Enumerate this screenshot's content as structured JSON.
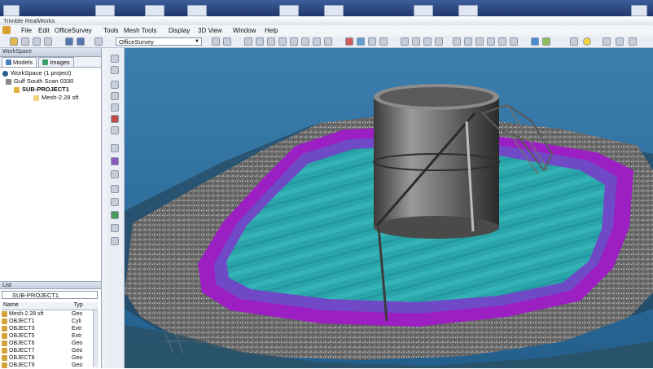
{
  "window": {
    "title": "Trimble RealWorks"
  },
  "menu": [
    "File",
    "Edit",
    "OfficeSurvey",
    "Tools",
    "Mesh Tools",
    "Display",
    "3D View",
    "Window",
    "Help"
  ],
  "toolbar": {
    "project_select": "OfficeSurvey"
  },
  "workspace": {
    "panel_title": "WorkSpace",
    "tabs": [
      "Models",
      "Images"
    ],
    "tree": [
      {
        "label": "WorkSpace (1 project)",
        "level": 0
      },
      {
        "label": "Gulf South Scan 0330",
        "level": 1
      },
      {
        "label": "SUB-PROJECT1",
        "level": 2
      },
      {
        "label": "Mesh-2.28 sft",
        "level": 3
      }
    ]
  },
  "list_panel": {
    "title": "List",
    "select": "SUB-PROJECT1",
    "columns": [
      "Name",
      "Typ"
    ],
    "rows": [
      {
        "name": "Mesh-2.28 sft",
        "type": "Geo"
      },
      {
        "name": "OBJECT1",
        "type": "Cyli"
      },
      {
        "name": "OBJECT3",
        "type": "Extr"
      },
      {
        "name": "OBJECT5",
        "type": "Extr"
      },
      {
        "name": "OBJECT6",
        "type": "Geo"
      },
      {
        "name": "OBJECT7",
        "type": "Geo"
      },
      {
        "name": "OBJECT8",
        "type": "Geo"
      },
      {
        "name": "OBJECT9",
        "type": "Geo"
      }
    ]
  },
  "colors": {
    "accent": "#2b4b8a",
    "water": "#2fb0b0",
    "water_edge": "#a020c0",
    "viewport_bg": "#2e6f9c"
  }
}
